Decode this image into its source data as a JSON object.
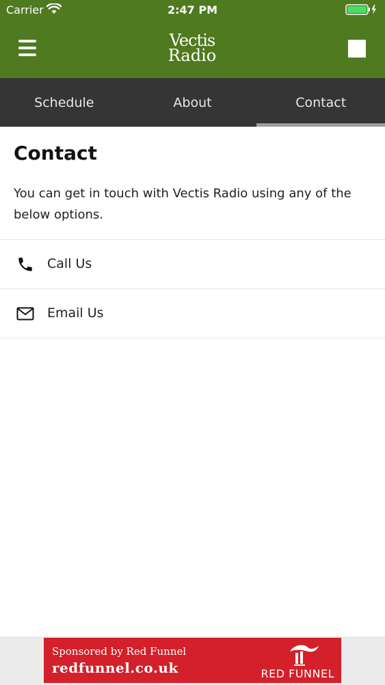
{
  "status_bar": {
    "carrier": "Carrier",
    "time": "2:47 PM"
  },
  "header": {
    "logo_line1": "Vectis",
    "logo_line2": "Radio",
    "menu_icon": "hamburger-menu-icon",
    "stop_icon": "stop-icon",
    "background_color": "#4f7a1f"
  },
  "tabs": [
    {
      "label": "Schedule",
      "active": false
    },
    {
      "label": "About",
      "active": false
    },
    {
      "label": "Contact",
      "active": true
    }
  ],
  "page": {
    "title": "Contact",
    "intro": "You can get in touch with Vectis Radio using any of the below options."
  },
  "contact_options": [
    {
      "label": "Call Us",
      "icon": "phone-icon"
    },
    {
      "label": "Email Us",
      "icon": "envelope-icon"
    }
  ],
  "ad": {
    "line1": "Sponsored by Red Funnel",
    "line2": "redfunnel.co.uk",
    "brand": "RED FUNNEL",
    "color": "#d3202a"
  }
}
